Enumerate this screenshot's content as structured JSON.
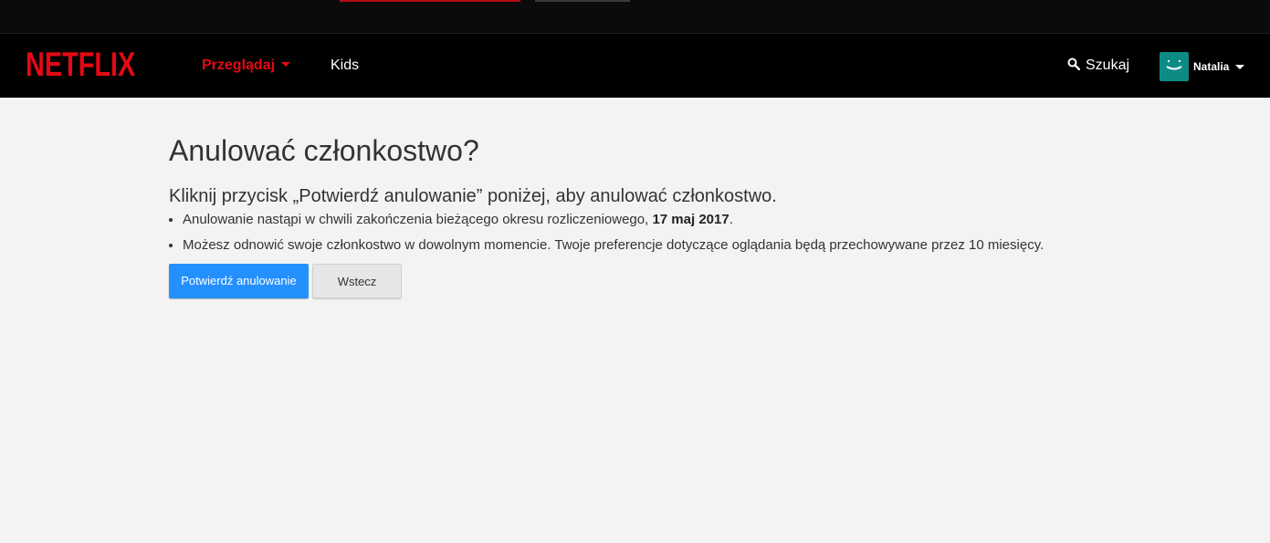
{
  "app": {
    "logo_text": "NETFLIX",
    "brand_color": "#e50914"
  },
  "nav": {
    "browse_label": "Przeglądaj",
    "kids_label": "Kids",
    "search_label": "Szukaj",
    "profile_name": "Natalia",
    "avatar_color": "#0f8b86"
  },
  "main": {
    "title": "Anulować członkostwo?",
    "subtitle": "Kliknij przycisk „Potwierdź anulowanie” poniżej, aby anulować członkostwo.",
    "bullets": {
      "first_text": "Anulowanie nastąpi w chwili zakończenia bieżącego okresu rozliczeniowego, ",
      "first_date": "17 maj 2017",
      "first_end": ".",
      "second_text": "Możesz odnowić swoje członkostwo w dowolnym momencie. Twoje preferencje dotyczące oglądania będą przechowywane przez 10 miesięcy."
    },
    "confirm_button": "Potwierdź anulowanie",
    "back_button": "Wstecz",
    "accent_color": "#2490fd"
  }
}
